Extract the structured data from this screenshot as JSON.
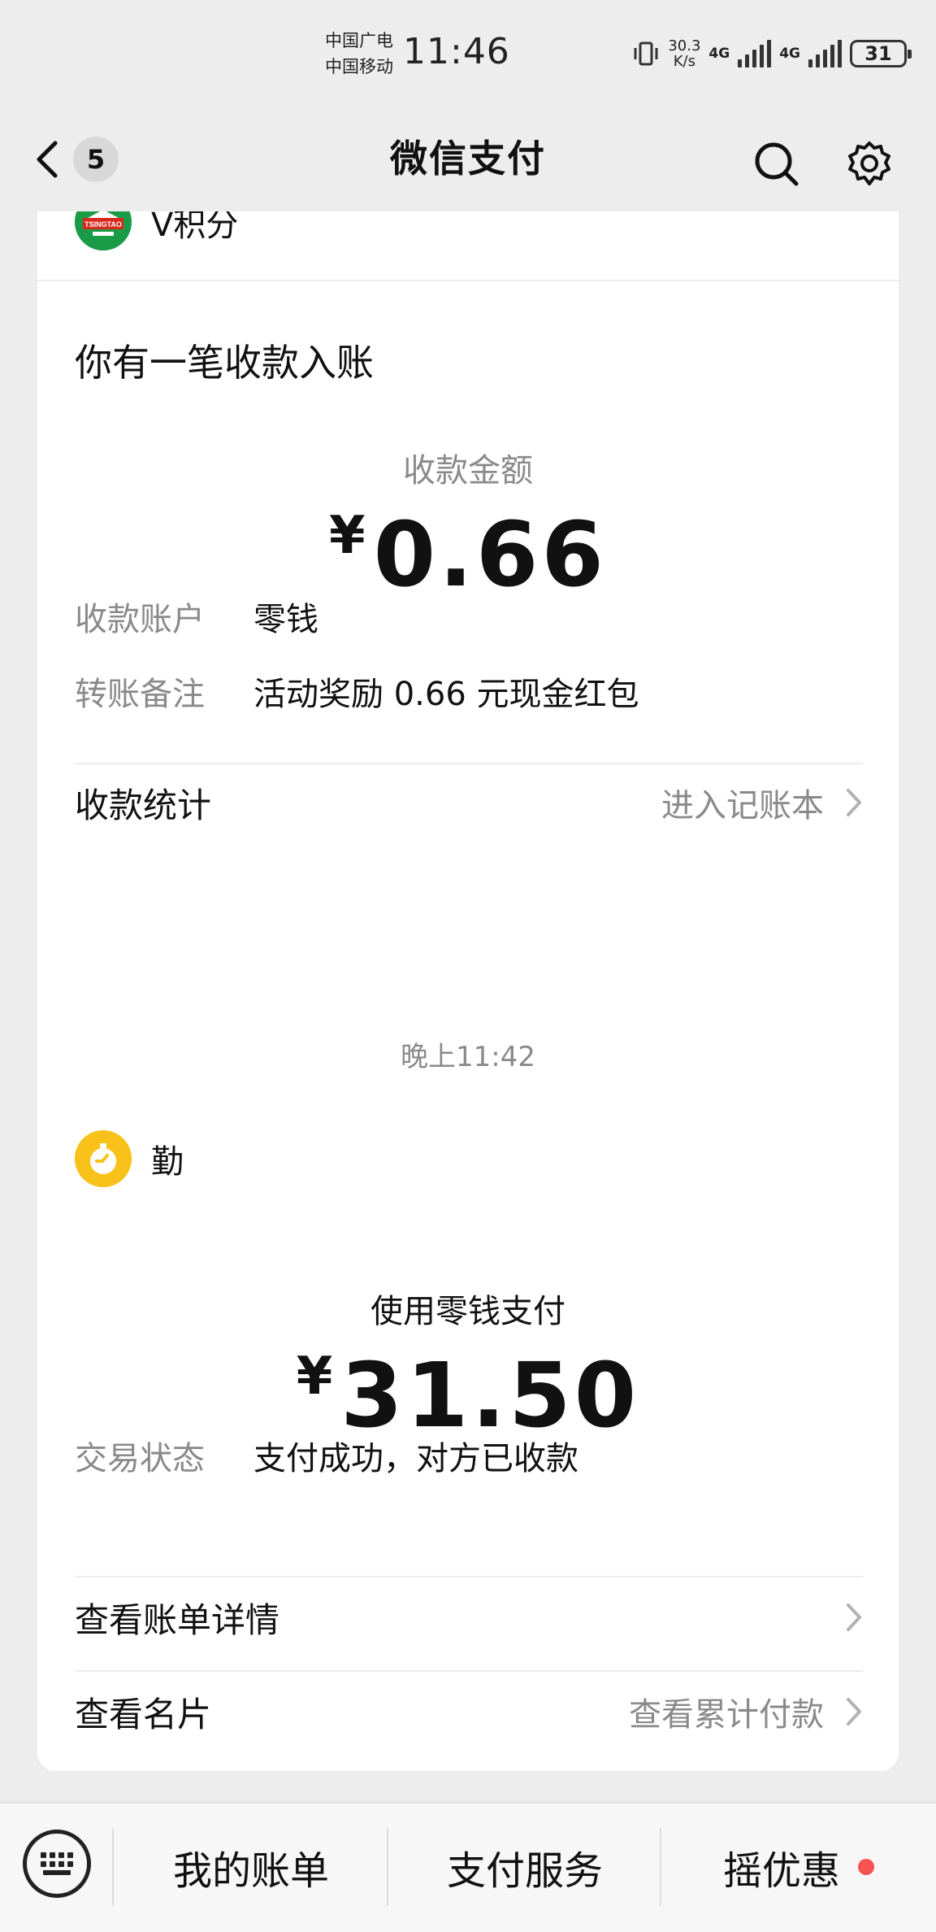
{
  "status_bar": {
    "carrier_1": "中国广电",
    "carrier_2": "中国移动",
    "time": "11:46",
    "net_speed_value": "30.3",
    "net_speed_unit": "K/s",
    "network_1": "4G",
    "network_2": "4G",
    "battery": "31"
  },
  "nav": {
    "unread_count": "5",
    "title": "微信支付"
  },
  "card_receipt": {
    "merchant_name": "V积分",
    "logo_text": "TSINGTAO",
    "notice_title": "你有一笔收款入账",
    "amount_label": "收款金额",
    "currency": "¥",
    "amount": "0.66",
    "rows": [
      {
        "key": "收款账户",
        "value": "零钱"
      },
      {
        "key": "转账备注",
        "value": "活动奖励 0.66 元现金红包"
      }
    ],
    "footer_label": "收款统计",
    "footer_action": "进入记账本"
  },
  "timestamp": "晚上11:42",
  "card_payment": {
    "merchant_name": "勤",
    "amount_label": "使用零钱支付",
    "currency": "¥",
    "amount": "31.50",
    "rows": [
      {
        "key": "交易状态",
        "value": "支付成功，对方已收款"
      }
    ],
    "link_1_label": "查看账单详情",
    "link_2_label": "查看名片",
    "link_2_action": "查看累计付款"
  },
  "bottom_bar": {
    "tabs": [
      "我的账单",
      "支付服务",
      "摇优惠"
    ]
  },
  "colors": {
    "background": "#ededed",
    "card": "#ffffff",
    "secondary_text": "#8a8a8a",
    "notification_dot": "#fa5151",
    "merchant_1_logo": "#1a9b48",
    "merchant_2_logo": "#f9c21a"
  }
}
